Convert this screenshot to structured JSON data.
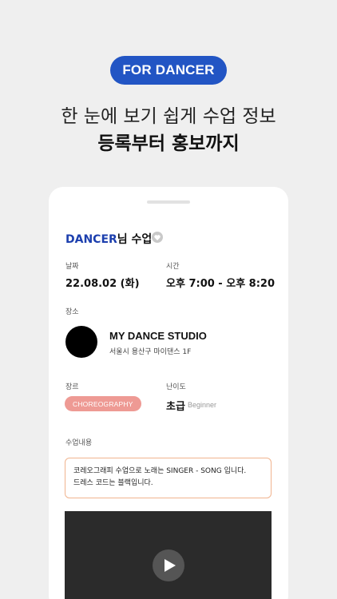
{
  "header": {
    "badge": "FOR DANCER",
    "line1": "한 눈에 보기 쉽게 수업 정보",
    "line2": "등록부터 홍보까지"
  },
  "card": {
    "title_highlight": "DANCER",
    "title_suffix": "님 수업",
    "date_label": "날짜",
    "date_value": "22.08.02 (화)",
    "time_label": "시간",
    "time_value": "오후 7:00 - 오후 8:20",
    "place_label": "장소",
    "studio_name": "MY DANCE STUDIO",
    "studio_address": "서울시 용산구 마이댄스 1F",
    "genre_label": "장르",
    "genre_value": "CHOREOGRAPHY",
    "level_label": "난이도",
    "level_value": "초급",
    "level_en": "Beginner",
    "desc_label": "수업내용",
    "desc_line1": "코레오그래피 수업으로 노래는 SINGER - SONG 입니다.",
    "desc_line2": "드레스 코드는 블랙입니다."
  },
  "colors": {
    "accent_blue": "#2255c4",
    "dancer_text": "#1c3fae",
    "genre_chip": "#ee9a94",
    "desc_border": "#f0b48f"
  },
  "icons": {
    "heart": "heart-icon",
    "play": "play-icon"
  }
}
